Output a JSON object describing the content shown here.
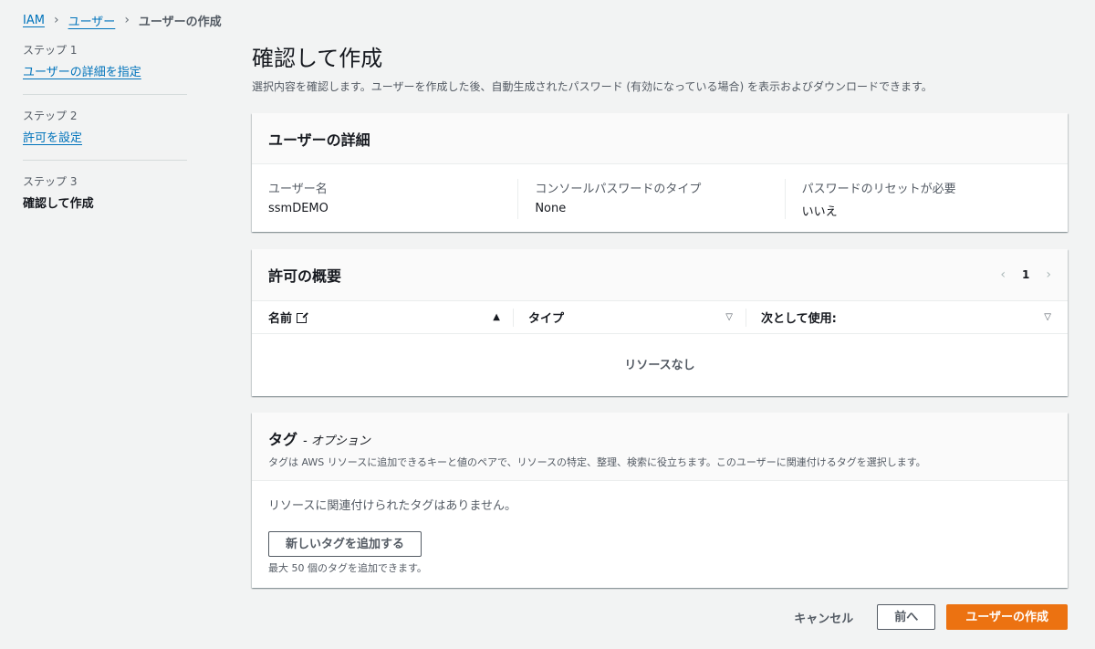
{
  "breadcrumb": {
    "root": "IAM",
    "parent": "ユーザー",
    "current": "ユーザーの作成"
  },
  "steps": [
    {
      "label": "ステップ 1",
      "title": "ユーザーの詳細を指定"
    },
    {
      "label": "ステップ 2",
      "title": "許可を設定"
    },
    {
      "label": "ステップ 3",
      "title": "確認して作成"
    }
  ],
  "page": {
    "title": "確認して作成",
    "description": "選択内容を確認します。ユーザーを作成した後、自動生成されたパスワード (有効になっている場合) を表示およびダウンロードできます。"
  },
  "user_details": {
    "title": "ユーザーの詳細",
    "fields": [
      {
        "key": "ユーザー名",
        "value": "ssmDEMO"
      },
      {
        "key": "コンソールパスワードのタイプ",
        "value": "None"
      },
      {
        "key": "パスワードのリセットが必要",
        "value": "いいえ"
      }
    ]
  },
  "permissions": {
    "title": "許可の概要",
    "page_number": "1",
    "columns": [
      "名前",
      "タイプ",
      "次として使用:"
    ],
    "empty_text": "リソースなし"
  },
  "tags": {
    "title": "タグ",
    "optional": "- オプション",
    "description": "タグは AWS リソースに追加できるキーと値のペアで、リソースの特定、整理、検索に役立ちます。このユーザーに関連付けるタグを選択します。",
    "none_text": "リソースに関連付けられたタグはありません。",
    "add_button": "新しいタグを追加する",
    "limit_text": "最大 50 個のタグを追加できます。"
  },
  "actions": {
    "cancel": "キャンセル",
    "previous": "前へ",
    "create": "ユーザーの作成"
  },
  "colors": {
    "link": "#0073bb",
    "primary": "#ec7211",
    "background": "#f2f3f3"
  }
}
